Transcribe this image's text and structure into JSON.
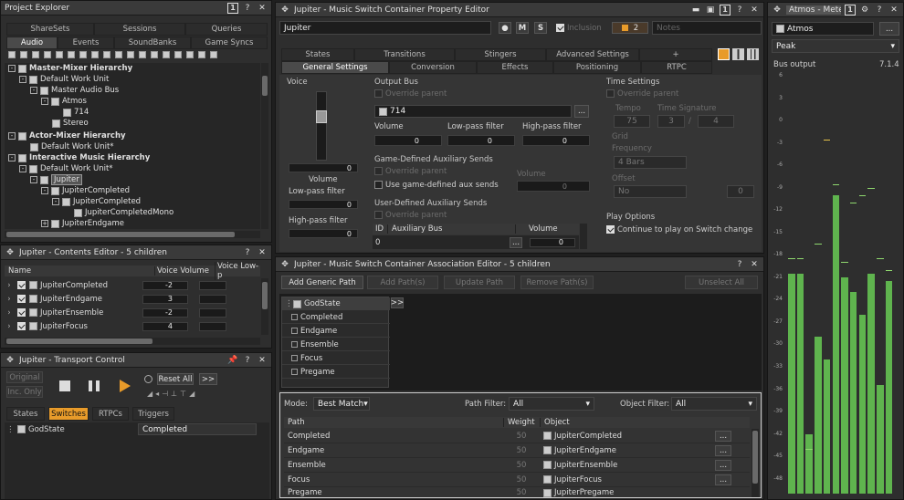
{
  "project_explorer": {
    "title": "Project Explorer",
    "tabs_row1": [
      "ShareSets",
      "Sessions",
      "Queries"
    ],
    "tabs_row2": [
      "Audio",
      "Events",
      "SoundBanks",
      "Game Syncs"
    ],
    "tree": [
      {
        "label": "Master-Mixer Hierarchy",
        "bold": true
      },
      {
        "label": "Default Work Unit"
      },
      {
        "label": "Master Audio Bus"
      },
      {
        "label": "Atmos"
      },
      {
        "label": "714"
      },
      {
        "label": "Stereo"
      },
      {
        "label": "Actor-Mixer Hierarchy",
        "bold": true
      },
      {
        "label": "Default Work Unit*"
      },
      {
        "label": "Interactive Music Hierarchy",
        "bold": true
      },
      {
        "label": "Default Work Unit*"
      },
      {
        "label": "Jupiter"
      },
      {
        "label": "JupiterCompleted"
      },
      {
        "label": "JupiterCompleted"
      },
      {
        "label": "JupiterCompletedMono"
      },
      {
        "label": "JupiterEndgame"
      }
    ]
  },
  "contents_editor": {
    "title": "Jupiter - Contents Editor - 5 children",
    "columns": [
      "Name",
      "Voice Volume",
      "Voice Low-p"
    ],
    "rows": [
      {
        "name": "JupiterCompleted",
        "volume": "-2"
      },
      {
        "name": "JupiterEndgame",
        "volume": "3"
      },
      {
        "name": "JupiterEnsemble",
        "volume": "-2"
      },
      {
        "name": "JupiterFocus",
        "volume": "4"
      }
    ]
  },
  "transport": {
    "title": "Jupiter - Transport Control",
    "original": "Original",
    "inc_only": "Inc. Only",
    "reset_all": "Reset All",
    "more": ">>",
    "tabs": [
      "States",
      "Switches",
      "RTPCs",
      "Triggers"
    ],
    "switch_group": "GodState",
    "switch_value": "Completed"
  },
  "property_editor": {
    "title": "Jupiter - Music Switch Container Property Editor",
    "name": "Jupiter",
    "m": "M",
    "s": "S",
    "inclusion": "Inclusion",
    "color_count": "2",
    "notes_placeholder": "Notes",
    "tabs_row1": [
      "States",
      "Transitions",
      "Stingers",
      "Advanced Settings",
      "+"
    ],
    "tabs_row2": [
      "General Settings",
      "Conversion",
      "Effects",
      "Positioning",
      "RTPC"
    ],
    "voice": {
      "label": "Voice",
      "volume_value": "0",
      "volume_label": "Volume",
      "lowpass_label": "Low-pass filter",
      "lowpass_value": "0",
      "highpass_label": "High-pass filter",
      "highpass_value": "0"
    },
    "output_bus": {
      "label": "Output Bus",
      "override": "Override parent",
      "bus_name": "714",
      "browse": "...",
      "volume_label": "Volume",
      "lowpass_label": "Low-pass filter",
      "highpass_label": "High-pass filter",
      "volume_value": "0",
      "lowpass_value": "0",
      "highpass_value": "0"
    },
    "game_aux": {
      "label": "Game-Defined Auxiliary Sends",
      "override": "Override parent",
      "use_game": "Use game-defined aux sends",
      "volume_label": "Volume",
      "volume_value": "0"
    },
    "user_aux": {
      "label": "User-Defined Auxiliary Sends",
      "override": "Override parent",
      "col_id": "ID",
      "col_bus": "Auxiliary Bus",
      "col_volume": "Volume",
      "row_id": "0",
      "row_volume": "0"
    },
    "time_settings": {
      "label": "Time Settings",
      "override": "Override parent",
      "tempo_label": "Tempo",
      "tempo_value": "75",
      "timesig_label": "Time Signature",
      "timesig_num": "3",
      "timesig_sep": "/",
      "timesig_den": "4",
      "grid_label": "Grid",
      "frequency_label": "Frequency",
      "frequency_value": "4 Bars",
      "offset_label": "Offset",
      "offset_value": "No",
      "offset_num": "0"
    },
    "play_options": {
      "label": "Play Options",
      "continue": "Continue to play on Switch change"
    }
  },
  "association_editor": {
    "title": "Jupiter - Music Switch Container Association Editor - 5 children",
    "buttons": [
      "Add Generic Path",
      "Add Path(s)",
      "Update Path",
      "Remove Path(s)",
      "Unselect All"
    ],
    "group": "GodState",
    "expand": ">>",
    "states": [
      "Completed",
      "Endgame",
      "Ensemble",
      "Focus",
      "Pregame"
    ],
    "mode_label": "Mode:",
    "mode_value": "Best Match",
    "path_filter_label": "Path Filter:",
    "path_filter_value": "All",
    "object_filter_label": "Object Filter:",
    "object_filter_value": "All",
    "columns": [
      "Path",
      "Weight",
      "Object"
    ],
    "rows": [
      {
        "path": "Completed",
        "weight": "50",
        "object": "JupiterCompleted"
      },
      {
        "path": "Endgame",
        "weight": "50",
        "object": "JupiterEndgame"
      },
      {
        "path": "Ensemble",
        "weight": "50",
        "object": "JupiterEnsemble"
      },
      {
        "path": "Focus",
        "weight": "50",
        "object": "JupiterFocus"
      },
      {
        "path": "Pregame",
        "weight": "50",
        "object": "JupiterPregame"
      }
    ],
    "browse": "..."
  },
  "meter": {
    "title": "Atmos - Meter",
    "bus": "Atmos",
    "browse": "...",
    "mode": "Peak",
    "bus_output_label": "Bus output",
    "channel_config": "7.1.4",
    "scale": [
      "6",
      "3",
      "0",
      "-3",
      "-6",
      "-9",
      "-12",
      "-15",
      "-18",
      "-21",
      "-24",
      "-27",
      "-30",
      "-33",
      "-36",
      "-39",
      "-42",
      "-45",
      "-48"
    ],
    "scale_range": [
      -50,
      6
    ],
    "levels_db": [
      -20.5,
      -20.5,
      -42,
      -29,
      -32,
      -10,
      -21,
      -23,
      -26,
      -20.5,
      -35.5,
      -21.5
    ],
    "peaks_db": [
      -18.5,
      -18.5,
      -44,
      -16.5,
      -2.5,
      -8.5,
      -19,
      -11,
      -10,
      -9,
      -18.5,
      -20
    ],
    "colors": {
      "bar": "#5fb44e",
      "peak_green": "#8fd86e",
      "peak_yellow": "#e6c24a",
      "accent": "#e89b2a"
    }
  }
}
